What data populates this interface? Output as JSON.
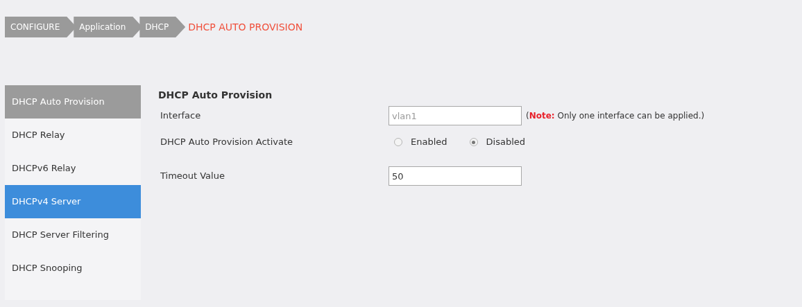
{
  "breadcrumb": [
    {
      "label": "CONFIGURE",
      "current": false
    },
    {
      "label": "Application",
      "current": false
    },
    {
      "label": "DHCP",
      "current": false
    },
    {
      "label": "DHCP AUTO PROVISION",
      "current": true
    }
  ],
  "sidebar": {
    "items": [
      {
        "label": "DHCP Auto Provision",
        "selected": true,
        "hovered": false
      },
      {
        "label": "DHCP Relay",
        "selected": false,
        "hovered": false
      },
      {
        "label": "DHCPv6 Relay",
        "selected": false,
        "hovered": false
      },
      {
        "label": "DHCPv4 Server",
        "selected": false,
        "hovered": true
      },
      {
        "label": "DHCP Server Filtering",
        "selected": false,
        "hovered": false
      },
      {
        "label": "DHCP Snooping",
        "selected": false,
        "hovered": false
      }
    ]
  },
  "form": {
    "title": "DHCP Auto Provision",
    "rows": [
      {
        "kind": "text",
        "label": "Interface",
        "value": "vlan1",
        "disabled": true,
        "note_label": "Note:",
        "note": " Only one interface can be applied.)",
        "note_open": "("
      },
      {
        "kind": "radio",
        "label": "DHCP Auto Provision Activate",
        "options": [
          {
            "label": "Enabled",
            "selected": false
          },
          {
            "label": "Disabled",
            "selected": true
          }
        ]
      },
      {
        "kind": "text",
        "label": "Timeout Value",
        "value": "50",
        "disabled": false
      }
    ]
  }
}
